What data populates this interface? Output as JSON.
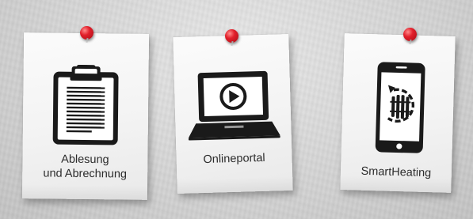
{
  "cards": [
    {
      "icon": "clipboard-icon",
      "label_line1": "Ablesung",
      "label_line2": "und Abrechnung"
    },
    {
      "icon": "laptop-play-icon",
      "label": "Onlineportal"
    },
    {
      "icon": "smartphone-radiator-icon",
      "label": "SmartHeating"
    }
  ],
  "colors": {
    "pin_red": "#e2202b",
    "paper": "#f6f6f6",
    "icon_black": "#1a1a1a",
    "background": "#d6d6d6"
  }
}
